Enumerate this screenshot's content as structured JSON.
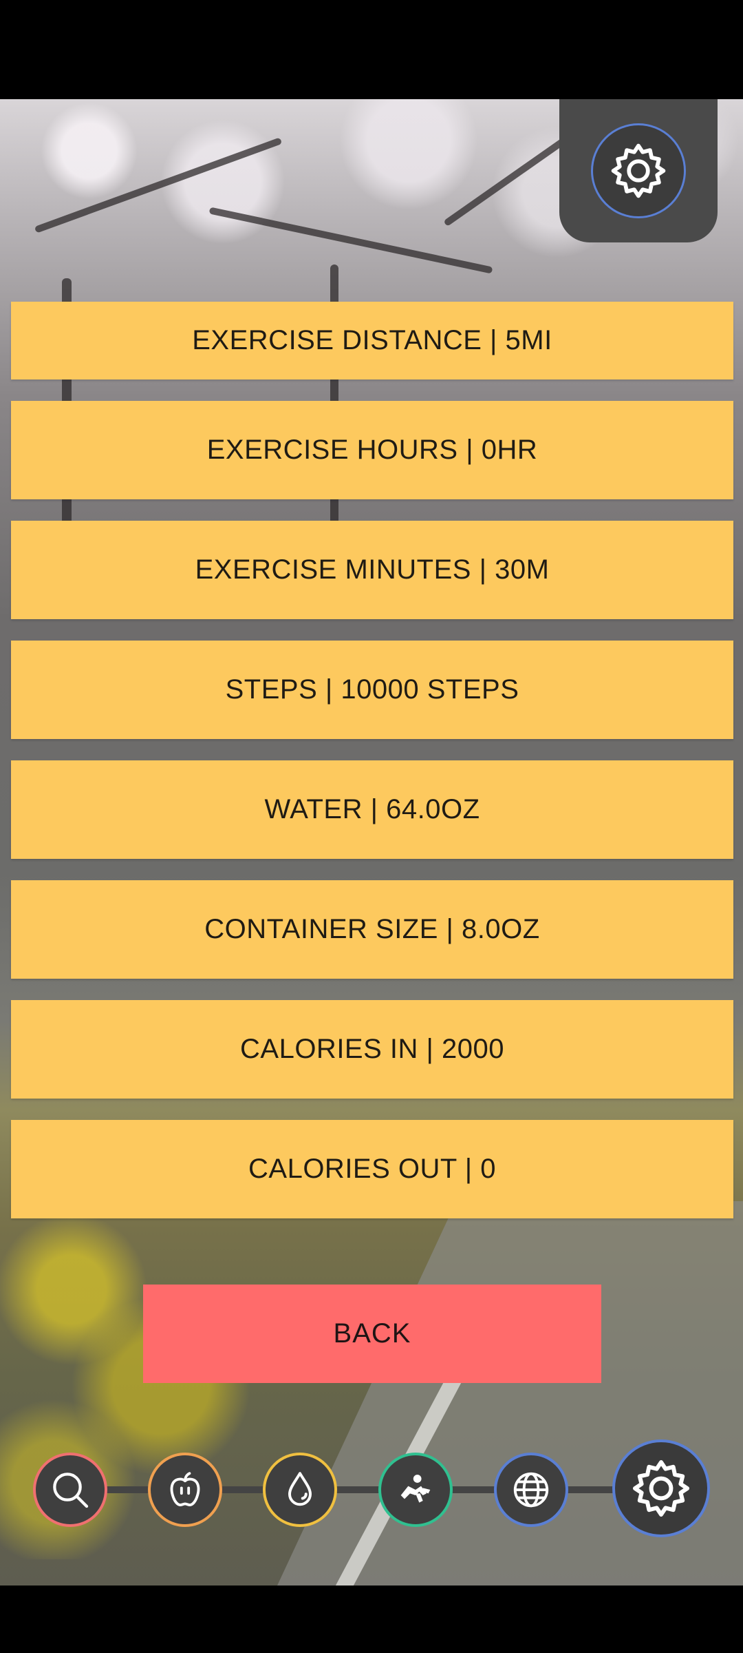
{
  "top_settings": {
    "icon": "gear-icon"
  },
  "goals": [
    {
      "label": "EXERCISE DISTANCE | 5MI"
    },
    {
      "label": "EXERCISE HOURS | 0HR"
    },
    {
      "label": "EXERCISE MINUTES | 30M"
    },
    {
      "label": "STEPS | 10000 STEPS"
    },
    {
      "label": "WATER | 64.0OZ"
    },
    {
      "label": "CONTAINER SIZE | 8.0OZ"
    },
    {
      "label": "CALORIES IN | 2000"
    },
    {
      "label": "CALORIES OUT | 0"
    }
  ],
  "back_label": "BACK",
  "bottom_nav": [
    {
      "icon": "search-icon",
      "color": "#f07070"
    },
    {
      "icon": "apple-icon",
      "color": "#f0a050"
    },
    {
      "icon": "water-drop-icon",
      "color": "#f0c040"
    },
    {
      "icon": "exercise-icon",
      "color": "#30c090"
    },
    {
      "icon": "globe-icon",
      "color": "#5a7fd4"
    },
    {
      "icon": "gear-icon",
      "color": "#5a7fd4"
    }
  ],
  "colors": {
    "goal_button": "#fdc95e",
    "back_button": "#ff6b6b"
  }
}
